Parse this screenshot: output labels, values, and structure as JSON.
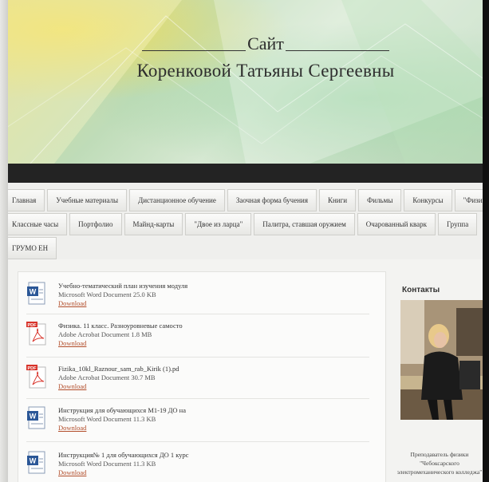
{
  "header": {
    "title_line1": "Сайт",
    "title_line2": "Коренковой Татьяны Сергеевны"
  },
  "nav": {
    "row1": [
      "Главная",
      "Учебные материалы",
      "Дистанционное обучение",
      "Заочная форма бучения",
      "Книги",
      "Фильмы",
      "Конкурсы",
      "\"Физикон\""
    ],
    "row2": [
      "Классные часы",
      "Портфолио",
      "Майнд-карты",
      "\"Двое из ларца\"",
      "Палитра, ставшая оружием",
      "Очарованный кварк",
      "Группа"
    ],
    "row3": [
      "ГРУМО ЕН"
    ]
  },
  "files": [
    {
      "icon": "word-doc-icon",
      "name": "Учебно-тематический план изучения модуля",
      "meta": "Microsoft Word Document 25.0 KB",
      "link": "Download"
    },
    {
      "icon": "pdf-icon",
      "name": "Физика. 11 класс. Разноуровневые самосто",
      "meta": "Adobe Acrobat Document 1.8 MB",
      "link": "Download"
    },
    {
      "icon": "pdf-icon",
      "name": "Fizika_10kl_Raznour_sam_rab_Kirik (1).pd",
      "meta": "Adobe Acrobat Document 30.7 MB",
      "link": "Download"
    },
    {
      "icon": "word-doc-icon",
      "name": "Инструкция для обучающихся М1-19 ДО на",
      "meta": "Microsoft Word Document 11.3 KB",
      "link": "Download"
    },
    {
      "icon": "word-doc-icon",
      "name": "Инструкция№ 1 для обучающихся ДО 1 курс",
      "meta": "Microsoft Word Document 11.3 KB",
      "link": "Download"
    }
  ],
  "sidebar": {
    "title": "Контакты",
    "caption_line1": "Преподаватель физики",
    "caption_line2": "\"Чебоксарского",
    "caption_line3": "электромеханического колледжа\""
  }
}
